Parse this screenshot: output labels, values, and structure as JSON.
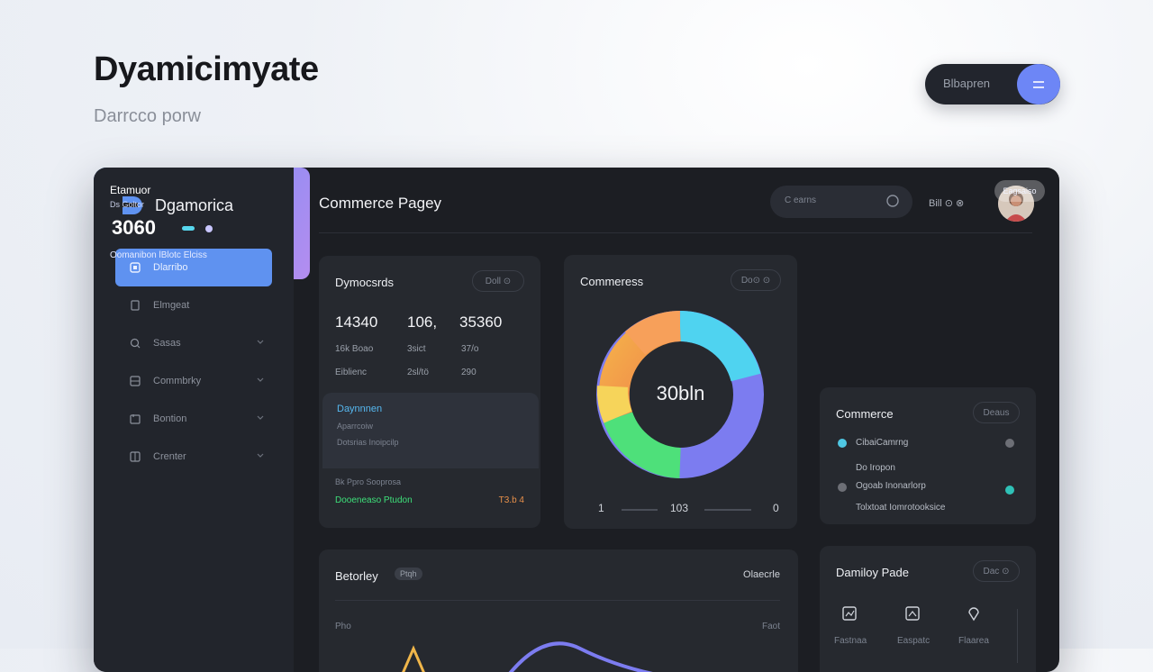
{
  "hero": {
    "title": "Dyamicimyate",
    "subtitle": "Darrcco porw"
  },
  "pill": {
    "label": "Blbapren"
  },
  "brand": {
    "name": "Dgamorica"
  },
  "sidebar": {
    "items": [
      {
        "label": "Dlarribo",
        "icon": "dashboard-icon",
        "active": true
      },
      {
        "label": "Elmgeat",
        "icon": "document-icon"
      },
      {
        "label": "Sasas",
        "icon": "search-icon"
      },
      {
        "label": "Commbrky",
        "icon": "grid-icon"
      },
      {
        "label": "Bontion",
        "icon": "calendar-icon"
      },
      {
        "label": "Crenter",
        "icon": "grid-icon"
      }
    ]
  },
  "header": {
    "title": "Commerce Pagey",
    "search_placeholder": "C earns",
    "meta": "Bill ⊙ ⊗"
  },
  "stats": {
    "title": "Dymocsrds",
    "filter": "Doll ⊙",
    "numbers": [
      "14340",
      "106,",
      "35360"
    ],
    "row1": [
      "16k Boao",
      "3sict",
      "37/o"
    ],
    "row2": [
      "Eiblienc",
      "2sl/tö",
      "290"
    ],
    "panel_title": "Daynnnen",
    "panel_lines": [
      "Aparrcoiw",
      "Dotsrias Inoipcilp"
    ],
    "foot_line": "Bk Ppro Sooprosa",
    "foot_green": "Dooeneaso Ptudon",
    "foot_value": "T3.b 4"
  },
  "donut": {
    "title": "Commeress",
    "filter": "Do⊙ ⊙",
    "center": "30bln",
    "legend_left": "1",
    "legend_mid": "103",
    "legend_right": "0"
  },
  "promo": {
    "title": "Etamuor",
    "sub": "Ds Goltor",
    "pill": "Eagsaiso",
    "number": "3060",
    "foot": "Oomanibon lBlotc Elciss"
  },
  "list": {
    "title": "Commerce",
    "pill": "Deaus",
    "rows": [
      "CibaiCamrng",
      "Do Iropon",
      "Ogoab Inonarlorp",
      "Tolxtoat Iomrotooksice"
    ]
  },
  "bottom": {
    "title": "Betorley",
    "tag": "Ptqh",
    "right": "Olaecrle",
    "axis_left": "Pho",
    "axis_right": "Faot"
  },
  "bottom2": {
    "title": "Damiloy Pade",
    "pill": "Dac ⊙",
    "icons": [
      {
        "label": "Fastnaa"
      },
      {
        "label": "Easpatc"
      },
      {
        "label": "Flaarea"
      }
    ]
  },
  "colors": {
    "accent": "#5f92f0",
    "card": "#26292f",
    "sidebar": "#22252c",
    "green": "#3ee07a",
    "orange": "#e8904a"
  }
}
